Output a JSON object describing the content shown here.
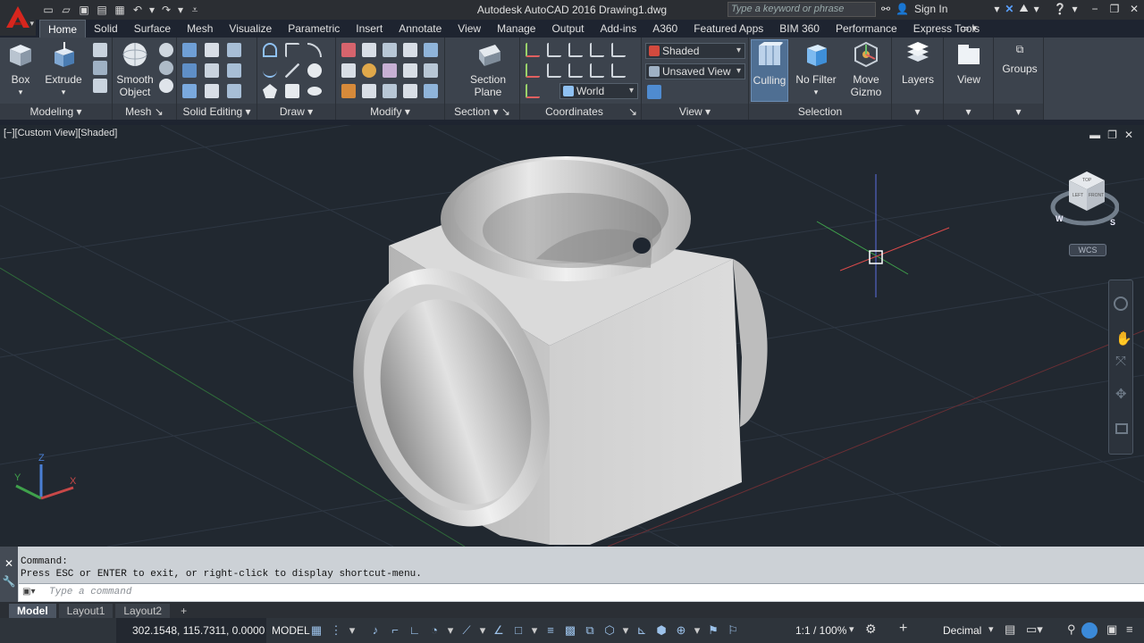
{
  "window": {
    "title": "Autodesk AutoCAD 2016   Drawing1.dwg",
    "search_placeholder": "Type a keyword or phrase",
    "sign_in": "Sign In"
  },
  "tabs": [
    "Home",
    "Solid",
    "Surface",
    "Mesh",
    "Visualize",
    "Parametric",
    "Insert",
    "Annotate",
    "View",
    "Manage",
    "Output",
    "Add-ins",
    "A360",
    "Featured Apps",
    "BIM 360",
    "Performance",
    "Express Tools"
  ],
  "ribbon": {
    "modeling": {
      "label": "Modeling",
      "box": "Box",
      "extrude": "Extrude"
    },
    "mesh": {
      "label": "Mesh",
      "smooth_object_1": "Smooth",
      "smooth_object_2": "Object"
    },
    "solid_editing": {
      "label": "Solid Editing"
    },
    "draw": {
      "label": "Draw"
    },
    "modify": {
      "label": "Modify"
    },
    "section": {
      "label": "Section",
      "section_plane_1": "Section",
      "section_plane_2": "Plane"
    },
    "coordinates": {
      "label": "Coordinates",
      "world": "World"
    },
    "view": {
      "label": "View",
      "visual_style": "Shaded",
      "named_view": "Unsaved View"
    },
    "selection": {
      "label": "Selection",
      "culling": "Culling",
      "no_filter": "No Filter",
      "move_gizmo_1": "Move",
      "move_gizmo_2": "Gizmo"
    },
    "layers": {
      "label": "Layers"
    },
    "view_panel": {
      "label": "View"
    },
    "groups": {
      "label": "Groups"
    }
  },
  "viewport": {
    "label": "[−][Custom View][Shaded]",
    "wcs": "WCS",
    "viewcube": {
      "top": "TOP",
      "left": "LEFT",
      "front": "FRONT",
      "compass_w": "W",
      "compass_s": "S"
    }
  },
  "command": {
    "history_1": "Command:",
    "history_2": "Press ESC or ENTER to exit, or right-click to display shortcut-menu.",
    "placeholder": "Type a command"
  },
  "layout_tabs": [
    "Model",
    "Layout1",
    "Layout2"
  ],
  "status": {
    "coords": "302.1548, 115.7311, 0.0000",
    "model": "MODEL",
    "scale": "1:1 / 100%",
    "units": "Decimal"
  },
  "colors": {
    "accent": "#3b8ad9",
    "background": "#212830",
    "logo_red": "#d7261e"
  }
}
